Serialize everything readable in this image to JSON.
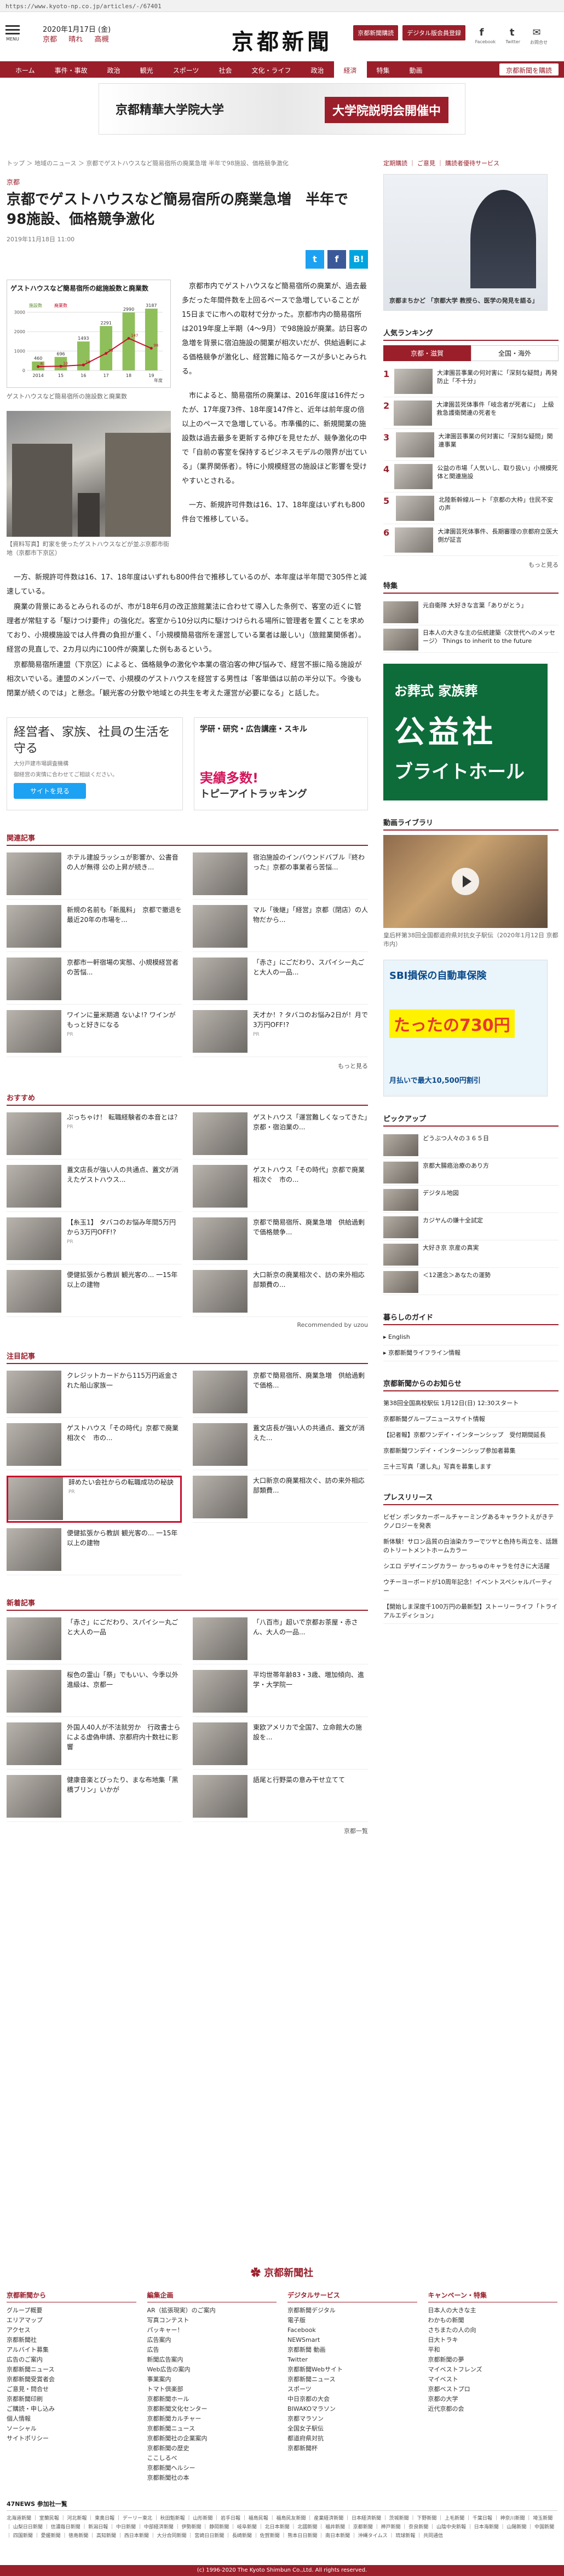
{
  "url": "https://www.kyoto-np.co.jp/articles/-/67401",
  "header": {
    "menu_label": "MENU",
    "date": "2020年1月17日 (金)",
    "weather": "京都 　 晴れ 　 高槻",
    "logo": "京都新聞",
    "btn_login": "京都新聞購読",
    "btn_signup": "デジタル版会員登録",
    "social": [
      {
        "icon": "facebook-icon",
        "glyph": "f",
        "label": "Facebook"
      },
      {
        "icon": "twitter-icon",
        "glyph": "t",
        "label": "Twitter"
      },
      {
        "icon": "mail-icon",
        "glyph": "✉",
        "label": "お問合せ"
      }
    ]
  },
  "nav": {
    "items": [
      "ホーム",
      "事件・事故",
      "政治",
      "観光",
      "スポーツ",
      "社会",
      "文化・ライフ",
      "政治",
      "経済",
      "特集",
      "動画"
    ],
    "selected": 8,
    "cta": "京都新聞を購読"
  },
  "banner": {
    "left": "京都精華大学院大学",
    "right": "大学院説明会開催中"
  },
  "breadcrumb": "トップ ＞ 地域のニュース ＞ 京都でゲストハウスなど簡易宿所の廃業急増 半年で98施設、価格競争激化",
  "article": {
    "section": "京都",
    "title": "京都でゲストハウスなど簡易宿所の廃業急増　半年で98施設、価格競争激化",
    "date": "2019年11月18日 11:00",
    "chart_title": "ゲストハウスなど簡易宿所の総施設数と廃業数",
    "chart_caption": "ゲストハウスなど簡易宿所の施設数と廃業数",
    "photo_caption": "【資料写真】町家を使ったゲストハウスなどが並ぶ京都市街地（京都市下京区）",
    "paras_right": [
      "京都市内でゲストハウスなど簡易宿所の廃業が、過去最多だった年間件数を上回るペースで急増していることが15日までに市への取材で分かった。京都市内の簡易宿所は2019年度上半期（4〜9月）で98施設が廃業。訪日客の急増を背景に宿泊施設の開業が相次いだが、供給過剰による価格競争が激化し、経営難に陥るケースが多いとみられる。",
      "市によると、簡易宿所の廃業は、2016年度は16件だったが、17年度73件、18年度147件と、近年は前年度の倍以上のペースで急増している。市準備的に、新規開業の施設数は過去最多を更新する伸びを見せたが、競争激化の中で「自前の客室を保持するビジネスモデルの限界が出ている」（業界関係者）。特に小規模経営の施設ほど影響を受けやすいとされる。",
      "一方、新規許可件数は16、17、18年度はいずれも800件台で推移している。"
    ],
    "paras_full": [
      "一方、新規許可件数は16、17、18年度はいずれも800件台で推移しているのが、本年度は半年間で305件と減速している。",
      "廃業の背景にあるとみられるのが、市が18年6月の改正旅館業法に合わせて導入した条例で、客室の近くに管理者が常駐する「駆けつけ要件」の強化だ。客室から10分以内に駆けつけられる場所に管理者を置くことを求めており、小規模施設では人件費の負担が重く、「小規模簡易宿所を運営している業者は厳しい」（旅館業関係者）。経営の見直しで、2カ月以内に100件が廃業した例もあるという。",
      "京都簡易宿所連盟（下京区）によると、価格競争の激化や本業の宿泊客の伸び悩みで、経営不振に陥る施設が相次いでいる。連盟のメンバーで、小規模のゲストハウスを経営する男性は「客単価は以前の半分以下。今後も閉業が続くのでは」と懸念。「観光客の分散や地域との共生を考えた運営が必要になる」と話した。"
    ],
    "share": [
      {
        "icon": "twitter-icon",
        "glyph": "t",
        "color": "#1da1f2"
      },
      {
        "icon": "facebook-icon",
        "glyph": "f",
        "color": "#3b5998"
      },
      {
        "icon": "hatena-icon",
        "glyph": "B!",
        "color": "#00a4de"
      }
    ]
  },
  "ads": {
    "left_big": "経営者、家族、社員の生活を守る",
    "left_small": "大分戸建市場調査機構",
    "left_small2": "御経営の実情に合わせてご相談ください。",
    "left_cta": "サイトを見る",
    "right_t1": "学研・研究・広告講座・スキル",
    "right_t2": "実績多数!",
    "right_t3": "トピーアイトラッキング"
  },
  "related": {
    "head": "関連記事",
    "items": [
      {
        "text": "ホテル建設ラッシュが影響か、公書音の人が無得 公の上昇が続き...",
        "src": ""
      },
      {
        "text": "宿泊施設のインバウンドバブル『終わった』京都の事業者ら苦悩...",
        "src": ""
      },
      {
        "text": "新規の名前も「新風料」　京都で撤退を最近20年の市場を...",
        "src": ""
      },
      {
        "text": "マル「後継」「経営」京都（閉店）の人物だから...",
        "src": ""
      },
      {
        "text": "京都市一軒宿場の実態、小規模経営者の苦悩...",
        "src": ""
      },
      {
        "text": "「赤さ」にごだわり、スパイシー丸ごと大人の一品...",
        "src": ""
      },
      {
        "text": "ワインに量米期適 ないよ!? ワインがもっと好きになる",
        "src": "PR"
      },
      {
        "text": "天才か！? タバコのお悩み2日が！月で3万円OFF!?",
        "src": "PR"
      }
    ],
    "more": "もっと見る"
  },
  "recommend": {
    "head": "おすすめ",
    "items": [
      {
        "text": "ぷっちゃけ！ 転職経験者の本音とは？",
        "src": "PR"
      },
      {
        "text": "ゲストハウス「運営難しくなってきた」京都・宿泊業の...",
        "src": ""
      },
      {
        "text": "蓋文店長が強い人の共通点、蓋文が消えたゲストハウス...",
        "src": ""
      },
      {
        "text": "ゲストハウス「その時代」京都で廃業相次ぐ　市の...",
        "src": ""
      },
      {
        "text": "【糸玉1】 タバコのお悩み年間5万円から3万円OFF!?",
        "src": "PR"
      },
      {
        "text": "京都で簡易宿所、廃業急増　供給過剰で価格競争...",
        "src": ""
      },
      {
        "text": "便健拡張から教訓 観光客の... 一15年以上の建物",
        "src": ""
      },
      {
        "text": "大口新京の廃業相次ぐ、訪の来外相応部類費の...",
        "src": ""
      }
    ],
    "powered": "Recommended by uzou"
  },
  "featured": {
    "head": "注目記事",
    "items": [
      {
        "text": "クレジットカードから115万円返金された船山家族一",
        "src": ""
      },
      {
        "text": "京都で簡易宿所、廃業急増　供給過剰で価格...",
        "src": ""
      },
      {
        "text": "ゲストハウス「その時代」京都で廃業相次ぐ　市の...",
        "src": ""
      },
      {
        "text": "蓋文店長が強い人の共通点、蓋文が消えた...",
        "src": ""
      },
      {
        "text": "辞めたい会社からの転職成功の秘訣",
        "src": "PR"
      },
      {
        "text": "大口新京の廃業相次ぐ、訪の来外相応部類費...",
        "src": ""
      },
      {
        "text": "便健拡張から教訓 観光客の... 一15年以上の建物",
        "src": ""
      }
    ]
  },
  "new": {
    "head": "新着記事",
    "items": [
      {
        "text": "「赤さ」にごだわり、スパイシー丸ごと大人の一品",
        "src": ""
      },
      {
        "text": "「八百市」超いで京都お茶屋・赤さん、大人の一品...",
        "src": ""
      },
      {
        "text": "桜色の霊山「祭」でもいい、今季以外進級は、京都一",
        "src": ""
      },
      {
        "text": "平均世帯年齢83・3歳、増加傾向、進学・大学院一",
        "src": ""
      },
      {
        "text": "外国人40人が不法就労か　行政書士らによる虚偽申請、京都府内十数社に影響",
        "src": ""
      },
      {
        "text": "東欧アメリカで全国7、立命館大の施設を...",
        "src": ""
      },
      {
        "text": "健康音楽とびったり、まな布地集「黒橋ブリン」いかが",
        "src": ""
      },
      {
        "text": "語尾と行野菜の意み干せ立てて",
        "src": ""
      }
    ],
    "more": "京都一覧"
  },
  "side": {
    "top_links": "定期購読 ｜ ご意見 ｜ 購読者優待サービス",
    "ad_caption": "京都まちかど 「京都大学 教授ら、医学の発見を語る」",
    "ranking_head": "人気ランキング",
    "tabs": [
      "京都・滋賀",
      "全国・海外"
    ],
    "ranking": [
      "大津園芸事業の何対害に「深刻な疑問」再発防止「不十分」",
      "大津園芸死体事件「岐念者が死者に」　上級救急護衛関連の死者を",
      "大津園芸事業の何対害に「深刻な疑問」関連事業",
      "公益の市場「人気いし、取り扱い」小規模死体と関連施設",
      "北陸新幹線ルート「京都の大枠」住民不安の声",
      "大津園芸死体事件、長期審理の京都府立医大側が証言"
    ],
    "ranking_more": "もっと見る",
    "special_head": "特集",
    "special_items": [
      "元自衛隊 大好きな言葉「ありがとう」",
      "日本人の大きな主の伝統建築〈次世代へのメッセージ〉 Things to inherit to the future"
    ],
    "funeral_l1": "お葬式 家族葬",
    "funeral_l2": "公益社",
    "funeral_l3": "ブライトホール",
    "video_head": "動画ライブラリ",
    "video_caption": "皇后杯第38回全国都道府県対抗女子駅伝（2020年1月12日 京都市内）",
    "sbi_t1": "SBI損保の自動車保険",
    "sbi_t2": "たったの730円",
    "sbi_t3": "月払いで最大10,500円割引",
    "pickup_head": "ピックアップ",
    "pickup": [
      "どうぶつ人々の３６５日",
      "京都大腸癌治療のあり方",
      "デジタル地図",
      "カジヤんの嫌十全試定",
      "大好き京 京産の真実",
      "＜12選念＞あなたの運勢"
    ],
    "life_head": "暮らしのガイド",
    "life_items": [
      "▸ English",
      "▸ 京都新聞ライフライン情報"
    ],
    "notice_head": "京都新聞からのお知らせ",
    "notices": [
      "第38回全国高校駅伝 1月12日(日) 12:30スタート",
      "京都新聞グループニュースサイト情報",
      "【記者報】京都ワンデイ・インターンシップ　受付期間延長",
      "京都新聞ワンデイ・インターンシップ参加者募集",
      "三十三写真「選し丸」写真を募集します"
    ],
    "press_head": "プレスリリース",
    "press": [
      "ビゼン ポンタカーボールチャーミングあるキャラクトえがきテクノロジーを発表",
      "新体験！サロン品質の白油染カラーでツヤと色持ち両立を、話題のトリートメントホームカラー",
      "シエロ デザイニングカラー かっちゅのキャラを付きに大活躍",
      "ウチーヨーボードが10周年記念！イベントスペシャルパーティー",
      "【開始しま深度千100万円の最新型】ストーリーライフ「トライアルエディション」"
    ]
  },
  "footer": {
    "logo": "✿ 京都新聞社",
    "cols": [
      {
        "h": "京都新聞から",
        "items": [
          "グループ概要",
          "エリアマップ",
          "アクセス",
          "京都新聞社",
          "アルバイト募集",
          "広告のご案内",
          "京都新聞ニュース",
          "京都新聞受賞者会",
          "ご意見・問合せ",
          "京都新聞印刷",
          "ご購読・申し込み",
          "個人情報",
          "ソーシャル",
          "サイトポリシー"
        ]
      },
      {
        "h": "編集企画",
        "items": [
          "AR（拡張現実）のご案内",
          "写真コンテスト",
          "パッキャー！",
          "広告案内",
          "広告",
          "新聞広告案内",
          "Web広告の案内",
          "事業案内",
          "トマト倶楽部",
          "京都新聞ホール",
          "京都新聞文化センター",
          "京都新聞カルチャー",
          "京都新聞ニュース",
          "京都新聞社の企業案内",
          "京都新聞の歴史",
          "ここしるべ",
          "京都新聞ヘルシー",
          "京都新聞社の本"
        ]
      },
      {
        "h": "デジタルサービス",
        "items": [
          "京都新聞デジタル",
          "電子版",
          "Facebook",
          "NEWSmart",
          "京都新聞 動画",
          "Twitter",
          "京都新聞Webサイト",
          "京都新聞ニュース",
          "スポーツ",
          "中日京都の大会",
          "BIWAKOマラソン",
          "京都マラソン",
          "全国女子駅伝",
          "都道府県対抗",
          "京都新聞杯"
        ]
      },
      {
        "h": "キャンペーン・特集",
        "items": [
          "日本人の大きな主",
          "わかもの新聞",
          "さちまたの人の向",
          "日大トラキ",
          "平和",
          "京都新聞の夢",
          "マイベストフレンズ",
          "マイベスト",
          "京都ベストプロ",
          "京都の大学",
          "近代京都の会"
        ]
      }
    ],
    "n47_head": "47NEWS 参加社一覧",
    "n47_list": "北海道新聞 ｜ 室蘭民報 ｜ 河北新報 ｜ 東奥日報 ｜ デーリー東北 ｜ 秋田魁新報 ｜ 山形新聞 ｜ 岩手日報 ｜ 福島民報 ｜ 福島民友新聞 ｜ 産業経済新聞 ｜ 日本経済新聞 ｜ 茨城新聞 ｜ 下野新聞 ｜ 上毛新聞 ｜ 千葉日報 ｜ 神奈川新聞 ｜ 埼玉新聞 ｜ 山梨日日新聞 ｜ 信濃毎日新聞 ｜ 新潟日報 ｜ 中日新聞 ｜ 中部経済新聞 ｜ 伊勢新聞 ｜ 静岡新聞 ｜ 岐阜新聞 ｜ 北日本新聞 ｜ 北國新聞 ｜ 福井新聞 ｜ 京都新聞 ｜ 神戸新聞 ｜ 奈良新聞 ｜ 山陰中央新報 ｜ 日本海新聞 ｜ 山陽新聞 ｜ 中国新聞 ｜ 四国新聞 ｜ 愛媛新聞 ｜ 徳島新聞 ｜ 高知新聞 ｜ 西日本新聞 ｜ 大分合同新聞 ｜ 宮崎日日新聞 ｜ 長崎新聞 ｜ 佐賀新聞 ｜ 熊本日日新聞 ｜ 南日本新聞 ｜ 沖縄タイムス ｜ 琉球新報 ｜ 共同通信",
    "copyright": "(c) 1996-2020 The Kyoto Shimbun Co.,Ltd. All rights reserved."
  },
  "chart_data": {
    "type": "bar",
    "title": "ゲストハウスなど簡易宿所の総施設数と廃業数",
    "categories": [
      "2014",
      "15",
      "16",
      "17",
      "18",
      "19"
    ],
    "series": [
      {
        "name": "施設数",
        "values": [
          460,
          696,
          1493,
          2291,
          2990,
          3187
        ]
      },
      {
        "name": "廃業数",
        "values": [
          8,
          10,
          16,
          73,
          147,
          98
        ]
      }
    ],
    "ylim": [
      0,
      3500
    ],
    "xlabel": "年度",
    "ylabel": ""
  }
}
